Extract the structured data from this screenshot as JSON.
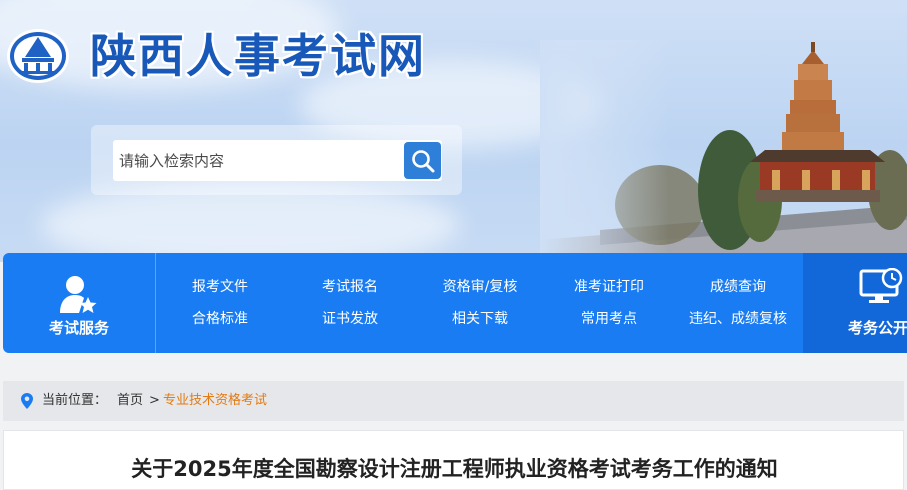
{
  "site": {
    "name": "陕西人事考试网",
    "logo_icon": "pagoda-emblem-icon"
  },
  "search": {
    "placeholder": "请输入检索内容",
    "button_icon": "search-icon"
  },
  "nav": {
    "service": {
      "label": "考试服务",
      "icon": "user-star-icon"
    },
    "links_row1": [
      "报考文件",
      "考试报名",
      "资格审/复核",
      "准考证打印",
      "成绩查询"
    ],
    "links_row2": [
      "合格标准",
      "证书发放",
      "相关下载",
      "常用考点",
      "违纪、成绩复核"
    ],
    "right": {
      "label": "考务公开",
      "icon": "monitor-clock-icon"
    }
  },
  "breadcrumb": {
    "prefix": "当前位置：",
    "home": "首页",
    "separator": ">",
    "current": "专业技术资格考试",
    "icon": "location-pin-icon"
  },
  "article": {
    "title": "关于2025年度全国勘察设计注册工程师执业资格考试考务工作的通知"
  },
  "colors": {
    "nav_blue": "#1a7cf2",
    "brand_blue": "#1758b8",
    "crumb_highlight": "#e37a12"
  }
}
